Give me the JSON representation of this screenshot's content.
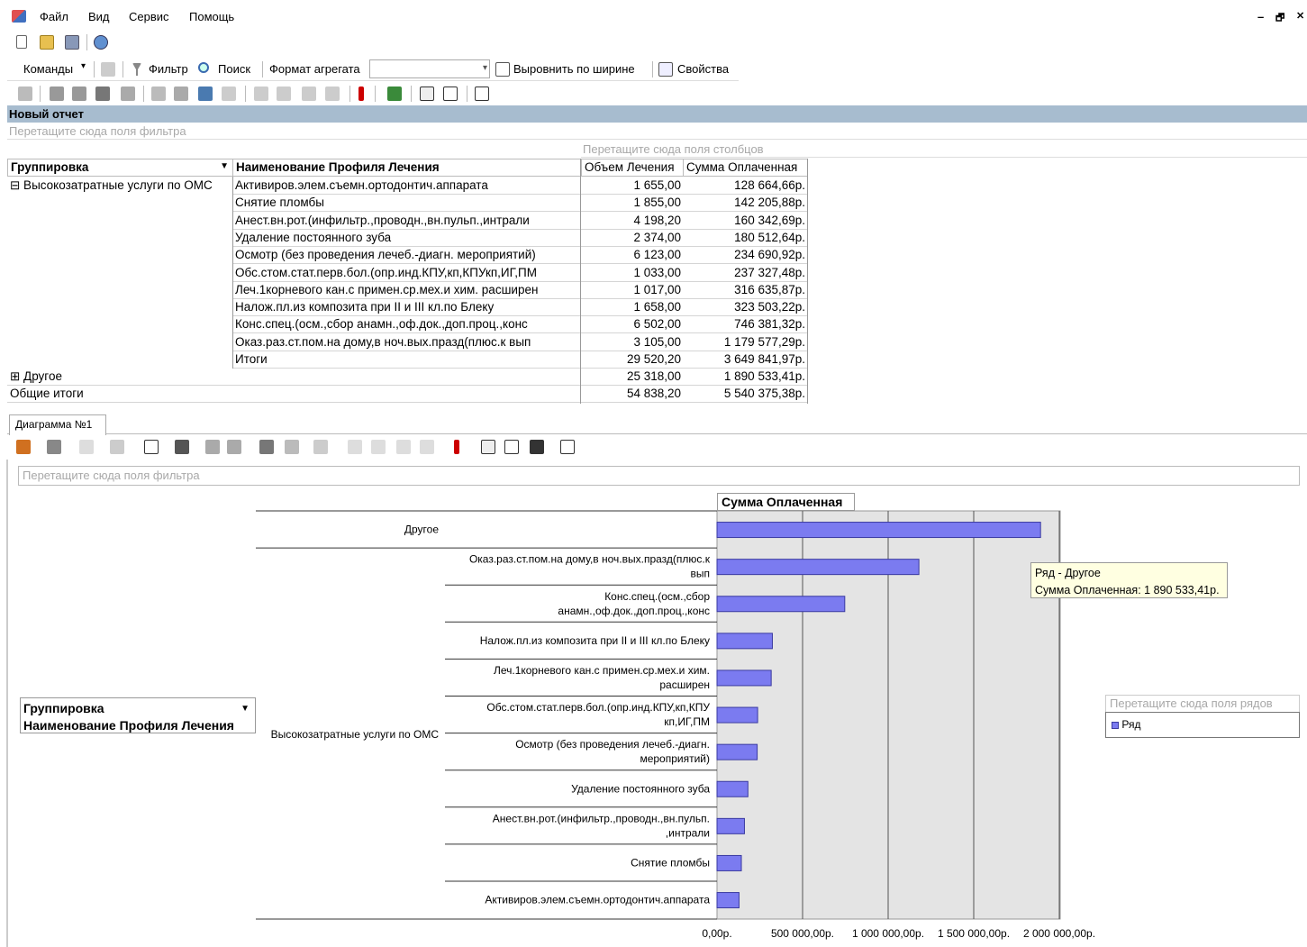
{
  "menu": {
    "file": "Файл",
    "view": "Вид",
    "service": "Сервис",
    "help": "Помощь"
  },
  "window_controls": {
    "minimize": "–",
    "restore": "🗗",
    "close": "✕"
  },
  "toolbar": {
    "commands": "Команды",
    "filter": "Фильтр",
    "search": "Поиск",
    "aggregate_format": "Формат агрегата",
    "aggregate_value": "",
    "fit_width": "Выровнить по ширине",
    "properties": "Свойства"
  },
  "report": {
    "title": "Новый отчет",
    "filter_drop": "Перетащите сюда поля фильтра",
    "column_drop": "Перетащите сюда поля столбцов"
  },
  "pivot": {
    "row_header_1": "Группировка",
    "row_header_2": "Наименование Профиля Лечения",
    "col_header_1": "Объем Лечения",
    "col_header_2": "Сумма Оплаченная",
    "group1": "⊟ Высокозатратные услуги по ОМС",
    "rows": [
      {
        "name": "Активиров.элем.съемн.ортодонтич.аппарата",
        "volume": "1 655,00",
        "sum": "128 664,66р."
      },
      {
        "name": "Снятие пломбы",
        "volume": "1 855,00",
        "sum": "142 205,88р."
      },
      {
        "name": "Анест.вн.рот.(инфильтр.,проводн.,вн.пульп.,интрали",
        "volume": "4 198,20",
        "sum": "160 342,69р."
      },
      {
        "name": "Удаление постоянного зуба",
        "volume": "2 374,00",
        "sum": "180 512,64р."
      },
      {
        "name": "Осмотр (без проведения лечеб.-диагн. мероприятий)",
        "volume": "6 123,00",
        "sum": "234 690,92р."
      },
      {
        "name": "Обс.стом.стат.перв.бол.(опр.инд.КПУ,кп,КПУкп,ИГ,ПМ",
        "volume": "1 033,00",
        "sum": "237 327,48р."
      },
      {
        "name": "Леч.1корневого кан.с примен.ср.мех.и хим. расширен",
        "volume": "1 017,00",
        "sum": "316 635,87р."
      },
      {
        "name": "Налож.пл.из композита при II и III кл.по Блеку",
        "volume": "1 658,00",
        "sum": "323 503,22р."
      },
      {
        "name": "Конс.спец.(осм.,сбор анамн.,оф.док.,доп.проц.,конс",
        "volume": "6 502,00",
        "sum": "746 381,32р."
      },
      {
        "name": "Оказ.раз.ст.пом.на дому,в ноч.вых.празд(плюс.к вып",
        "volume": "3 105,00",
        "sum": "1 179 577,29р."
      },
      {
        "name": "Итоги",
        "volume": "29 520,20",
        "sum": "3 649 841,97р."
      }
    ],
    "group2": "⊞ Другое",
    "group2_volume": "25 318,00",
    "group2_sum": "1 890 533,41р.",
    "total": "Общие итоги",
    "total_volume": "54 838,20",
    "total_sum": "5 540 375,38р."
  },
  "chart_tab": "Диаграмма №1",
  "chart_filter_drop": "Перетащите сюда поля фильтра",
  "chart_group_field_1": "Группировка",
  "chart_group_field_2": "Наименование Профиля Лечения",
  "chart_series_drop": "Перетащите сюда поля рядов",
  "chart_legend_item": "Ряд",
  "tooltip": {
    "line1": "Ряд - Другое",
    "line2": "Сумма Оплаченная: 1 890 533,41р."
  },
  "colors": {
    "bar": "#7b7bf0",
    "bar_border": "#3a3aa0",
    "plot_bg": "#e4e4e4",
    "header_bar": "#a7bccf"
  },
  "chart_data": {
    "type": "bar",
    "orientation": "horizontal",
    "title": "Сумма Оплаченная",
    "groups": [
      {
        "name": "Другое",
        "items": [
          "Другое"
        ]
      },
      {
        "name": "Высокозатратные услуги по ОМС",
        "items": [
          "Оказ.раз.ст.пом.на дому,в ноч.вых.празд(плюс.к вып",
          "Конс.спец.(осм.,сбор анамн.,оф.док.,доп.проц.,конс",
          "Налож.пл.из композита при II и III кл.по Блеку",
          "Леч.1корневого кан.с примен.ср.мех.и хим. расширен",
          "Обс.стом.стат.перв.бол.(опр.инд.КПУ,кп,КПУ кп,ИГ,ПМ",
          "Осмотр (без проведения лечеб.-диагн. мероприятий)",
          "Удаление постоянного зуба",
          "Анест.вн.рот.(инфильтр.,проводн.,вн.пульп. ,интрали",
          "Снятие пломбы",
          "Активиров.элем.съемн.ортодонтич.аппарата"
        ]
      }
    ],
    "categories": [
      "Другое",
      "Оказ.раз.ст.пом.на дому,в ноч.вых.празд(плюс.к вып",
      "Конс.спец.(осм.,сбор анамн.,оф.док.,доп.проц.,конс",
      "Налож.пл.из композита при II и III кл.по Блеку",
      "Леч.1корневого кан.с примен.ср.мех.и хим. расширен",
      "Обс.стом.стат.перв.бол.(опр.инд.КПУ,кп,КПУ кп,ИГ,ПМ",
      "Осмотр (без проведения лечеб.-диагн. мероприятий)",
      "Удаление постоянного зуба",
      "Анест.вн.рот.(инфильтр.,проводн.,вн.пульп. ,интрали",
      "Снятие пломбы",
      "Активиров.элем.съемн.ортодонтич.аппарата"
    ],
    "series": [
      {
        "name": "Ряд",
        "values": [
          1890533.41,
          1179577.29,
          746381.32,
          323503.22,
          316635.87,
          237327.48,
          234690.92,
          180512.64,
          160342.69,
          142205.88,
          128664.66
        ]
      }
    ],
    "xlim": [
      0,
      2000000
    ],
    "ticks": [
      0,
      500000,
      1000000,
      1500000,
      2000000
    ],
    "tick_labels": [
      "0,00р.",
      "500 000,00р.",
      "1 000 000,00р.",
      "1 500 000,00р.",
      "2 000 000,00р."
    ],
    "grid": true,
    "legend": "right"
  }
}
